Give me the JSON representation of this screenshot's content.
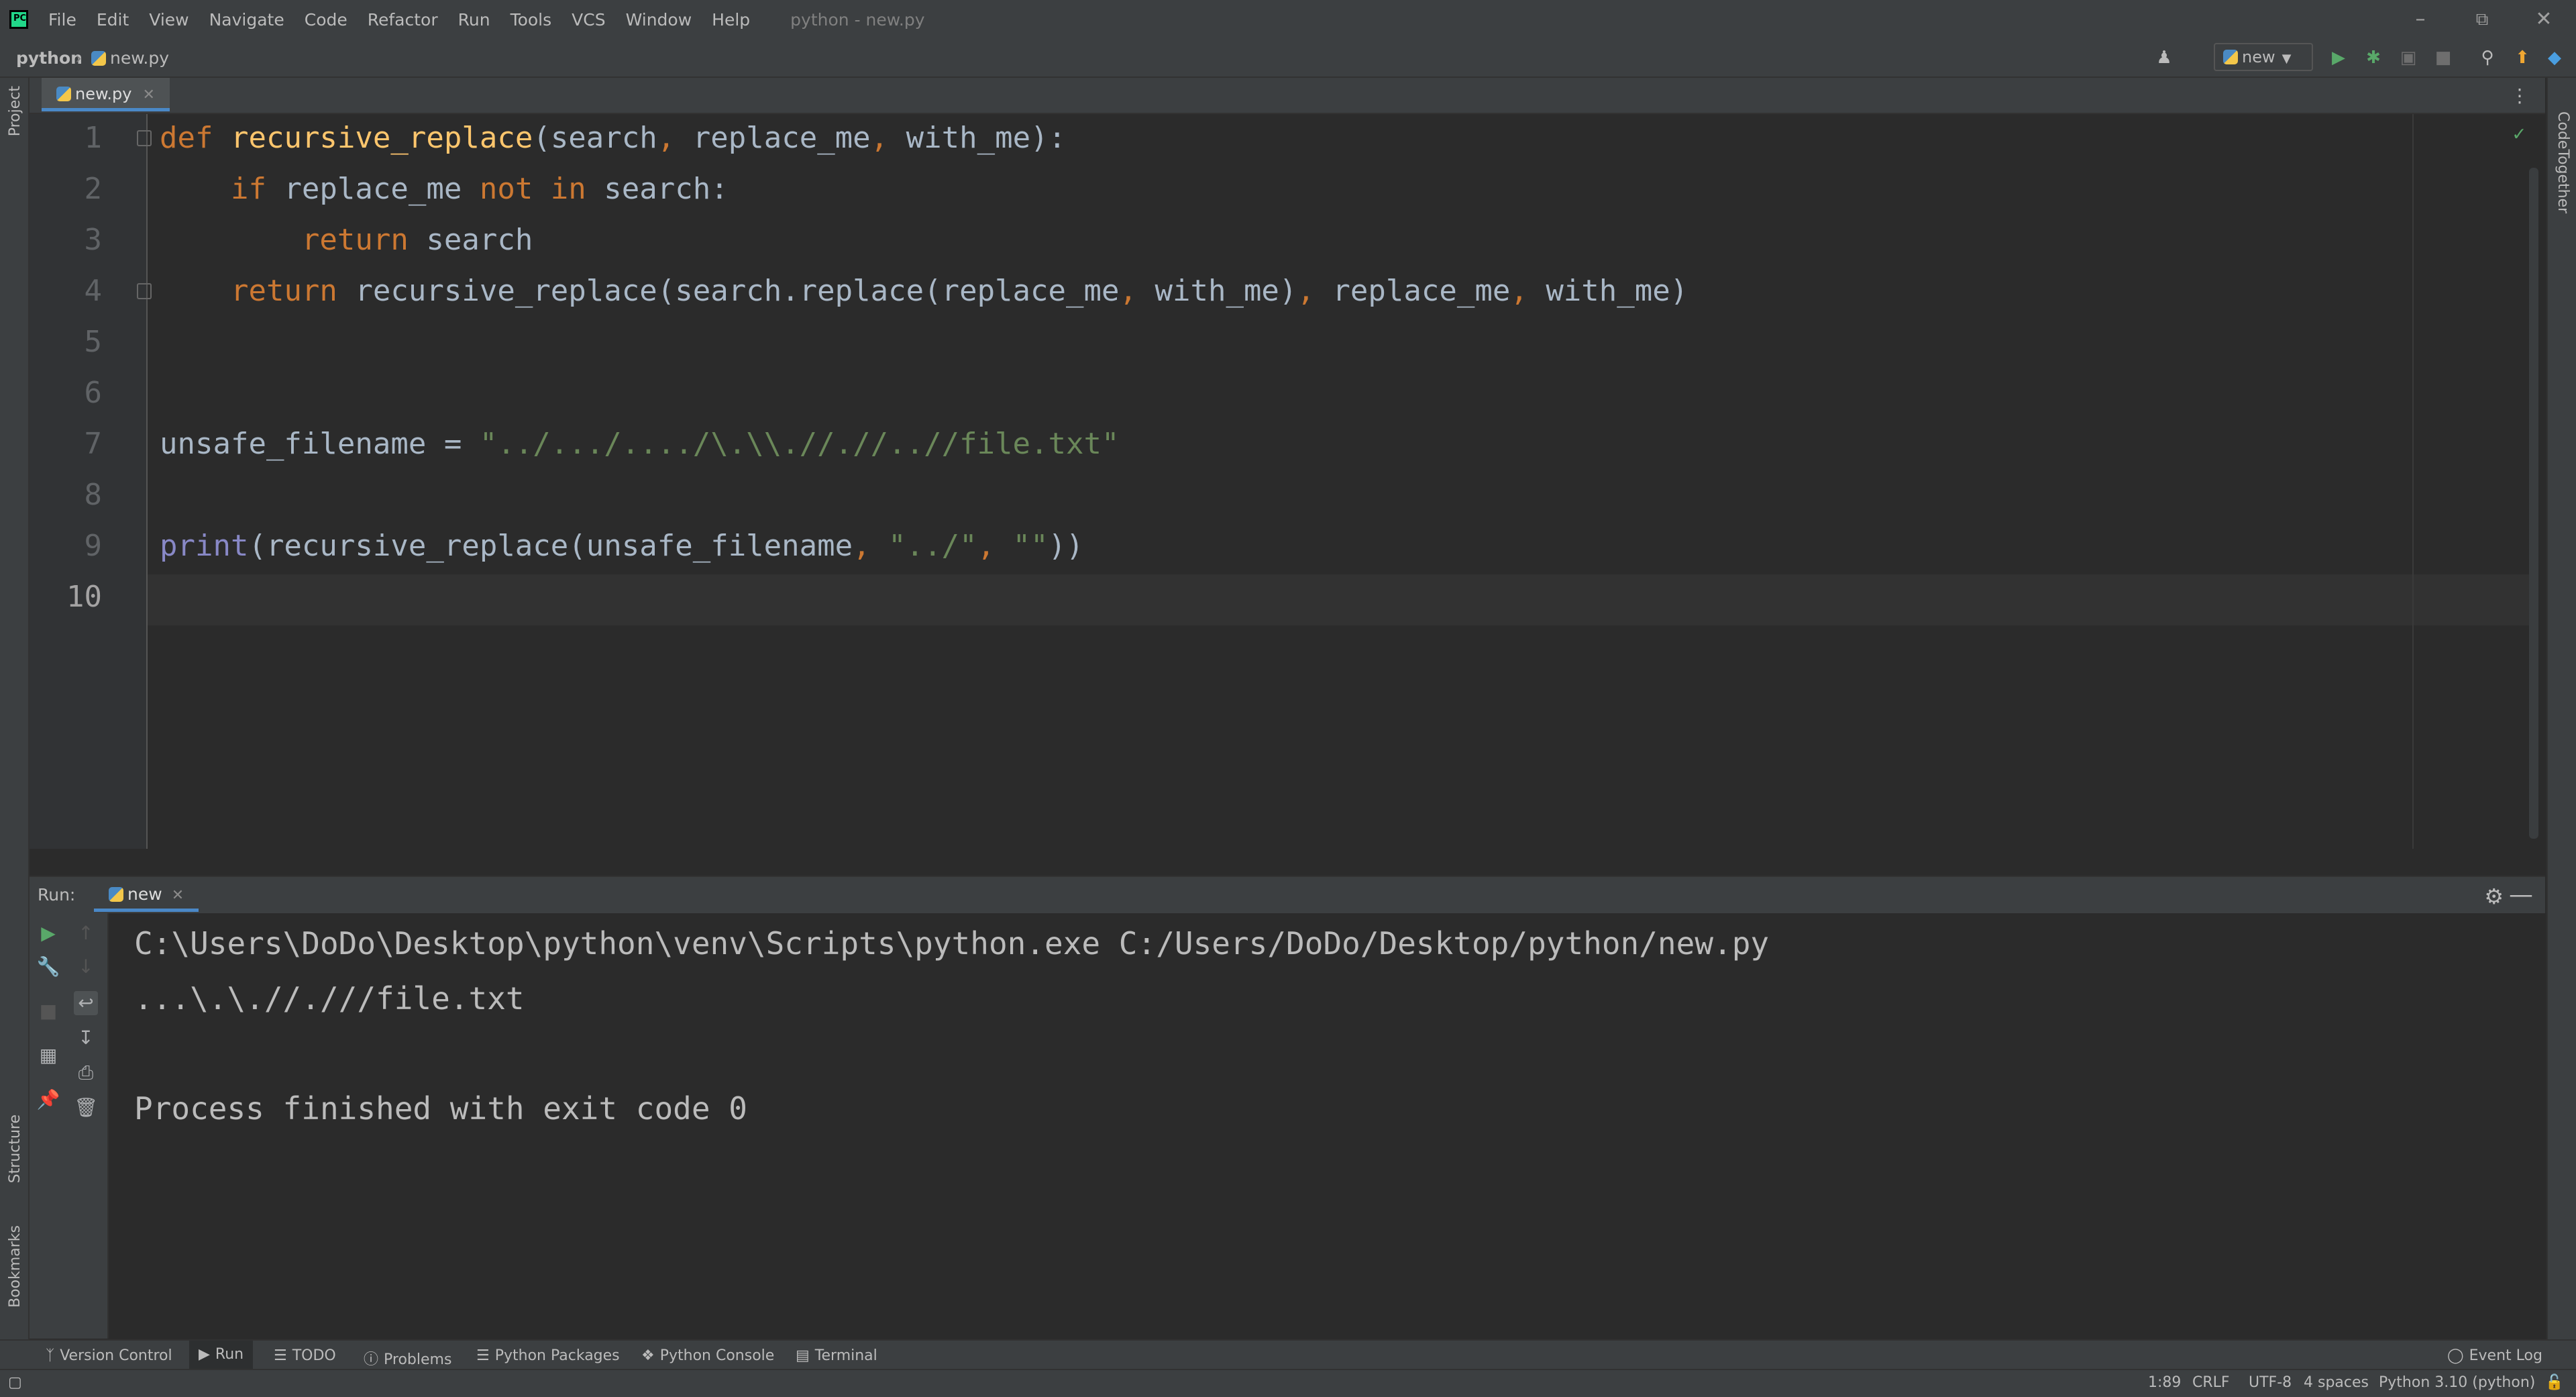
{
  "menu": {
    "items": [
      "File",
      "Edit",
      "View",
      "Navigate",
      "Code",
      "Refactor",
      "Run",
      "Tools",
      "VCS",
      "Window",
      "Help"
    ],
    "window_title": "python - new.py"
  },
  "navbar": {
    "project": "python",
    "file": "new.py",
    "run_config": "new"
  },
  "editor": {
    "tab_label": "new.py",
    "line_numbers": [
      "1",
      "2",
      "3",
      "4",
      "5",
      "6",
      "7",
      "8",
      "9",
      "10"
    ],
    "current_line": "10"
  },
  "tool_strips": {
    "left_top": "Project",
    "left_structure": "Structure",
    "left_bookmarks": "Bookmarks",
    "right": "CodeTogether"
  },
  "run_panel": {
    "title": "Run:",
    "tab_label": "new",
    "output": [
      "C:\\Users\\DoDo\\Desktop\\python\\venv\\Scripts\\python.exe C:/Users/DoDo/Desktop/python/new.py",
      "...\\.\\.//.///file.txt",
      "",
      "Process finished with exit code 0"
    ]
  },
  "bottom_tools": {
    "version_control": "Version Control",
    "run": "Run",
    "todo": "TODO",
    "problems": "Problems",
    "python_packages": "Python Packages",
    "python_console": "Python Console",
    "terminal": "Terminal",
    "event_log": "Event Log"
  },
  "status": {
    "position": "1:89",
    "line_sep": "CRLF",
    "encoding": "UTF-8",
    "indent": "4 spaces",
    "interpreter": "Python 3.10 (python)"
  },
  "colors": {
    "keyword": "#cc7832",
    "function": "#ffc66d",
    "string": "#6a8759",
    "builtin": "#8888c6",
    "accent": "#4a88c7"
  }
}
